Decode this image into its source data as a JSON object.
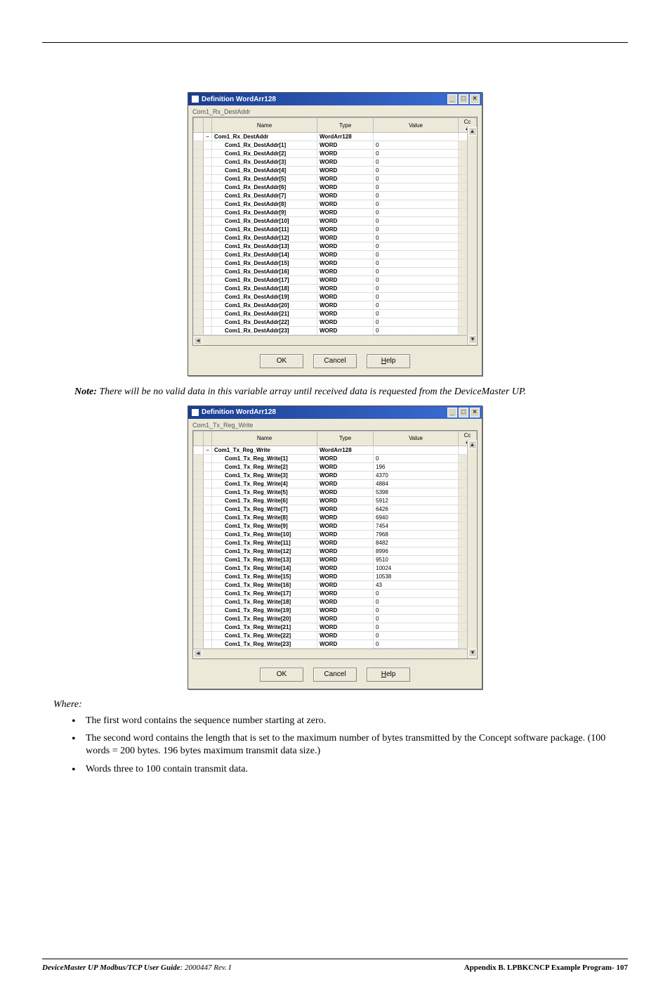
{
  "dialog1": {
    "title": "Definition WordArr128",
    "subheader": "Com1_Rx_DestAddr",
    "columns": {
      "name": "Name",
      "type": "Type",
      "value": "Value",
      "cc": "Cc"
    },
    "parent": {
      "name": "Com1_Rx_DestAddr",
      "type": "WordArr128",
      "value": ""
    },
    "rows": [
      {
        "name": "Com1_Rx_DestAddr[1]",
        "type": "WORD",
        "value": "0"
      },
      {
        "name": "Com1_Rx_DestAddr[2]",
        "type": "WORD",
        "value": "0"
      },
      {
        "name": "Com1_Rx_DestAddr[3]",
        "type": "WORD",
        "value": "0"
      },
      {
        "name": "Com1_Rx_DestAddr[4]",
        "type": "WORD",
        "value": "0"
      },
      {
        "name": "Com1_Rx_DestAddr[5]",
        "type": "WORD",
        "value": "0"
      },
      {
        "name": "Com1_Rx_DestAddr[6]",
        "type": "WORD",
        "value": "0"
      },
      {
        "name": "Com1_Rx_DestAddr[7]",
        "type": "WORD",
        "value": "0"
      },
      {
        "name": "Com1_Rx_DestAddr[8]",
        "type": "WORD",
        "value": "0"
      },
      {
        "name": "Com1_Rx_DestAddr[9]",
        "type": "WORD",
        "value": "0"
      },
      {
        "name": "Com1_Rx_DestAddr[10]",
        "type": "WORD",
        "value": "0"
      },
      {
        "name": "Com1_Rx_DestAddr[11]",
        "type": "WORD",
        "value": "0"
      },
      {
        "name": "Com1_Rx_DestAddr[12]",
        "type": "WORD",
        "value": "0"
      },
      {
        "name": "Com1_Rx_DestAddr[13]",
        "type": "WORD",
        "value": "0"
      },
      {
        "name": "Com1_Rx_DestAddr[14]",
        "type": "WORD",
        "value": "0"
      },
      {
        "name": "Com1_Rx_DestAddr[15]",
        "type": "WORD",
        "value": "0"
      },
      {
        "name": "Com1_Rx_DestAddr[16]",
        "type": "WORD",
        "value": "0"
      },
      {
        "name": "Com1_Rx_DestAddr[17]",
        "type": "WORD",
        "value": "0"
      },
      {
        "name": "Com1_Rx_DestAddr[18]",
        "type": "WORD",
        "value": "0"
      },
      {
        "name": "Com1_Rx_DestAddr[19]",
        "type": "WORD",
        "value": "0"
      },
      {
        "name": "Com1_Rx_DestAddr[20]",
        "type": "WORD",
        "value": "0"
      },
      {
        "name": "Com1_Rx_DestAddr[21]",
        "type": "WORD",
        "value": "0"
      },
      {
        "name": "Com1_Rx_DestAddr[22]",
        "type": "WORD",
        "value": "0"
      },
      {
        "name": "Com1_Rx_DestAddr[23]",
        "type": "WORD",
        "value": "0"
      }
    ],
    "buttons": {
      "ok": "OK",
      "cancel": "Cancel",
      "help": "elp",
      "help_u": "H"
    }
  },
  "note": {
    "label": "Note:",
    "body": "There will be no valid data in this variable array until received data is requested from the DeviceMaster UP."
  },
  "dialog2": {
    "title": "Definition WordArr128",
    "subheader": "Com1_Tx_Reg_Write",
    "columns": {
      "name": "Name",
      "type": "Type",
      "value": "Value",
      "cc": "Cc"
    },
    "parent": {
      "name": "Com1_Tx_Reg_Write",
      "type": "WordArr128",
      "value": ""
    },
    "rows": [
      {
        "name": "Com1_Tx_Reg_Write[1]",
        "type": "WORD",
        "value": "0"
      },
      {
        "name": "Com1_Tx_Reg_Write[2]",
        "type": "WORD",
        "value": "196"
      },
      {
        "name": "Com1_Tx_Reg_Write[3]",
        "type": "WORD",
        "value": "4370"
      },
      {
        "name": "Com1_Tx_Reg_Write[4]",
        "type": "WORD",
        "value": "4884"
      },
      {
        "name": "Com1_Tx_Reg_Write[5]",
        "type": "WORD",
        "value": "5398"
      },
      {
        "name": "Com1_Tx_Reg_Write[6]",
        "type": "WORD",
        "value": "5912"
      },
      {
        "name": "Com1_Tx_Reg_Write[7]",
        "type": "WORD",
        "value": "6426"
      },
      {
        "name": "Com1_Tx_Reg_Write[8]",
        "type": "WORD",
        "value": "6940"
      },
      {
        "name": "Com1_Tx_Reg_Write[9]",
        "type": "WORD",
        "value": "7454"
      },
      {
        "name": "Com1_Tx_Reg_Write[10]",
        "type": "WORD",
        "value": "7968"
      },
      {
        "name": "Com1_Tx_Reg_Write[11]",
        "type": "WORD",
        "value": "8482"
      },
      {
        "name": "Com1_Tx_Reg_Write[12]",
        "type": "WORD",
        "value": "8996"
      },
      {
        "name": "Com1_Tx_Reg_Write[13]",
        "type": "WORD",
        "value": "9510"
      },
      {
        "name": "Com1_Tx_Reg_Write[14]",
        "type": "WORD",
        "value": "10024"
      },
      {
        "name": "Com1_Tx_Reg_Write[15]",
        "type": "WORD",
        "value": "10538"
      },
      {
        "name": "Com1_Tx_Reg_Write[16]",
        "type": "WORD",
        "value": "43"
      },
      {
        "name": "Com1_Tx_Reg_Write[17]",
        "type": "WORD",
        "value": "0"
      },
      {
        "name": "Com1_Tx_Reg_Write[18]",
        "type": "WORD",
        "value": "0"
      },
      {
        "name": "Com1_Tx_Reg_Write[19]",
        "type": "WORD",
        "value": "0"
      },
      {
        "name": "Com1_Tx_Reg_Write[20]",
        "type": "WORD",
        "value": "0"
      },
      {
        "name": "Com1_Tx_Reg_Write[21]",
        "type": "WORD",
        "value": "0"
      },
      {
        "name": "Com1_Tx_Reg_Write[22]",
        "type": "WORD",
        "value": "0"
      },
      {
        "name": "Com1_Tx_Reg_Write[23]",
        "type": "WORD",
        "value": "0"
      }
    ],
    "buttons": {
      "ok": "OK",
      "cancel": "Cancel",
      "help": "elp",
      "help_u": "H"
    }
  },
  "where": "Where:",
  "bullets": [
    "The first word contains the sequence number starting at zero.",
    "The second word contains the length that is set to the maximum number of bytes transmitted by the Concept software package. (100 words = 200 bytes. 196 bytes maximum transmit data size.)",
    "Words three to 100 contain transmit data."
  ],
  "footer": {
    "left_bold": "DeviceMaster UP Modbus/TCP User Guide",
    "left_rest": ": 2000447 Rev. I",
    "right": "Appendix B. LPBKCNCP Example Program- 107"
  }
}
